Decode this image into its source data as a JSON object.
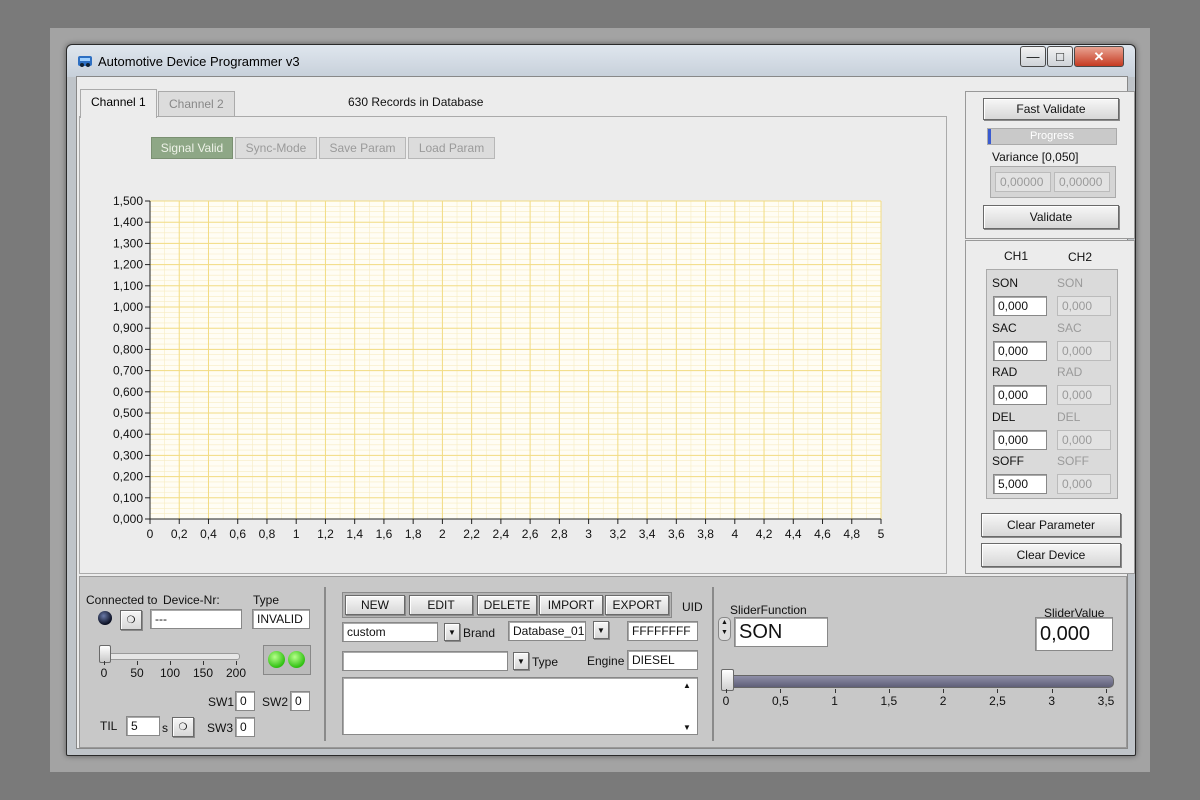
{
  "window": {
    "title": "Automotive Device Programmer v3"
  },
  "tabs": [
    {
      "label": "Channel 1"
    },
    {
      "label": "Channel 2"
    }
  ],
  "records_text": "630 Records in Database",
  "chart_toolbar": {
    "signal_valid": "Signal Valid",
    "sync_mode": "Sync-Mode",
    "save_param": "Save Param",
    "load_param": "Load Param"
  },
  "chart_data": {
    "type": "line",
    "series": [],
    "x_ticks": [
      "0",
      "0,2",
      "0,4",
      "0,6",
      "0,8",
      "1",
      "1,2",
      "1,4",
      "1,6",
      "1,8",
      "2",
      "2,2",
      "2,4",
      "2,6",
      "2,8",
      "3",
      "3,2",
      "3,4",
      "3,6",
      "3,8",
      "4",
      "4,2",
      "4,4",
      "4,6",
      "4,8",
      "5"
    ],
    "y_ticks": [
      "0,000",
      "0,100",
      "0,200",
      "0,300",
      "0,400",
      "0,500",
      "0,600",
      "0,700",
      "0,800",
      "0,900",
      "1,000",
      "1,100",
      "1,200",
      "1,300",
      "1,400",
      "1,500"
    ],
    "xlim": [
      0,
      5
    ],
    "ylim": [
      0,
      1.5
    ],
    "grid": true,
    "colors": {
      "background": "#fffdf4",
      "major_grid": "#f2dc83",
      "minor_grid": "#f7ecc2"
    }
  },
  "validation": {
    "fast_validate": "Fast Validate",
    "progress_label": "Progress",
    "progress_value": 0.02,
    "variance_label": "Variance [0,050]",
    "variance_values": [
      "0,00000",
      "0,00000"
    ],
    "validate": "Validate"
  },
  "parameters": {
    "ch1_header": "CH1",
    "ch2_header": "CH2",
    "rows": [
      {
        "name": "SON",
        "ch1": "0,000",
        "ch2": "0,000"
      },
      {
        "name": "SAC",
        "ch1": "0,000",
        "ch2": "0,000"
      },
      {
        "name": "RAD",
        "ch1": "0,000",
        "ch2": "0,000"
      },
      {
        "name": "DEL",
        "ch1": "0,000",
        "ch2": "0,000"
      },
      {
        "name": "SOFF",
        "ch1": "5,000",
        "ch2": "0,000"
      }
    ],
    "clear_parameter": "Clear Parameter",
    "clear_device": "Clear Device"
  },
  "connection": {
    "connected_label": "Connected to",
    "device_nr_label": "Device-Nr:",
    "device_nr_value": "---",
    "type_label": "Type",
    "type_value": "INVALID",
    "slider_ticks": [
      "0",
      "50",
      "100",
      "150",
      "200"
    ],
    "slider_value": 0,
    "sw1_label": "SW1",
    "sw1_value": "0",
    "sw2_label": "SW2",
    "sw2_value": "0",
    "sw3_label": "SW3",
    "sw3_value": "0",
    "til_label": "TIL",
    "til_value": "5",
    "til_unit": "s"
  },
  "database": {
    "buttons": [
      "NEW",
      "EDIT",
      "DELETE",
      "IMPORT",
      "EXPORT"
    ],
    "uid_label": "UID",
    "uid_value": "FFFFFFFF",
    "custom_value": "custom",
    "brand_label": "Brand",
    "database_value": "Database_01",
    "type_label": "Type",
    "type_value": "",
    "engine_label": "Engine",
    "engine_value": "DIESEL",
    "notes": ""
  },
  "slider_panel": {
    "function_label": "SliderFunction",
    "function_value": "SON",
    "value_label": "SliderValue",
    "value": "0,000",
    "ticks": [
      "0",
      "0,5",
      "1",
      "1,5",
      "2",
      "2,5",
      "3",
      "3,5"
    ],
    "position": 0
  }
}
